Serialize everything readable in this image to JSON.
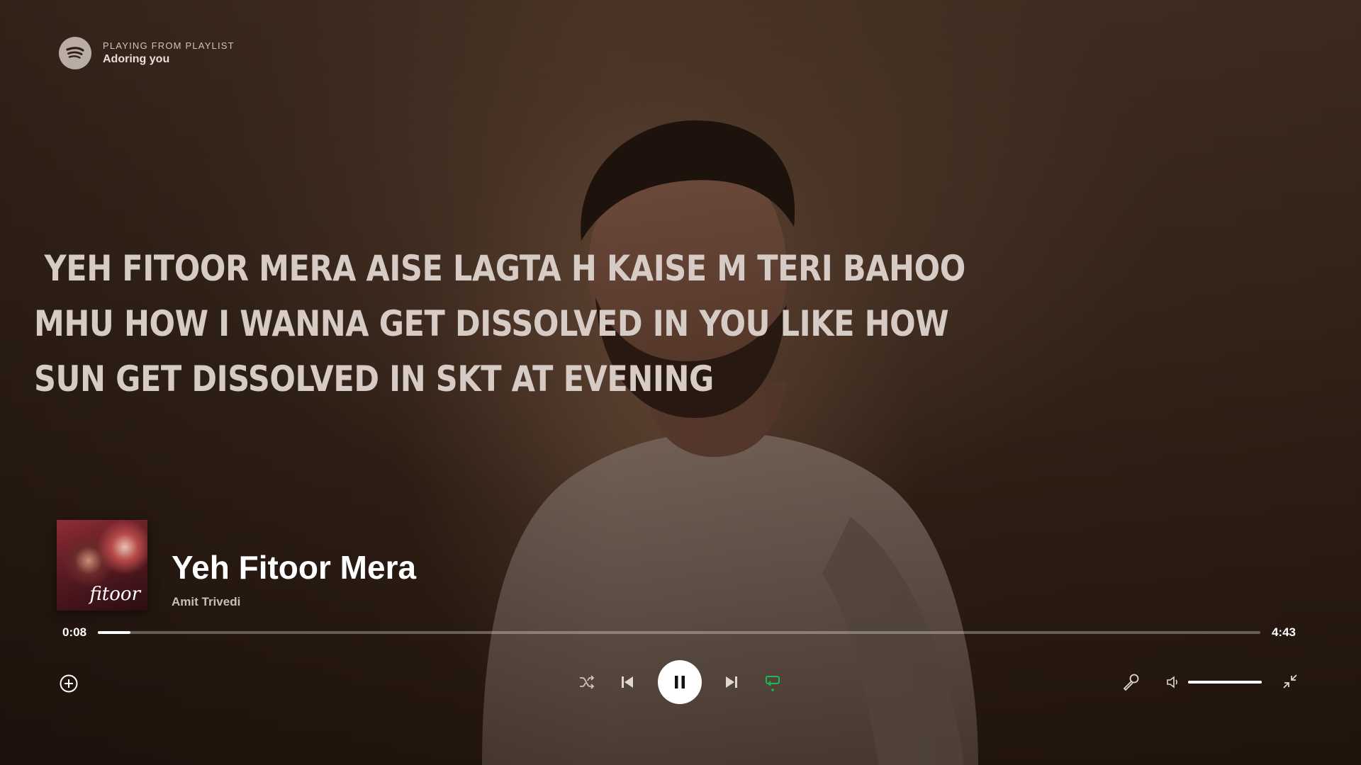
{
  "header": {
    "context_label": "PLAYING FROM PLAYLIST",
    "playlist_name": "Adoring you"
  },
  "lyrics": {
    "lines": [
      " YEH FITOOR MERA AISE LAGTA H KAISE M TERI BAHOO",
      "MHU HOW I WANNA GET DISSOLVED IN YOU LIKE HOW",
      "SUN GET DISSOLVED IN SKT AT EVENING"
    ]
  },
  "now_playing": {
    "cover_text": "fitoor",
    "title": "Yeh Fitoor Mera",
    "artist": "Amit Trivedi"
  },
  "progress": {
    "elapsed": "0:08",
    "duration": "4:43",
    "fraction": 0.028
  },
  "volume": {
    "fraction": 1.0
  },
  "colors": {
    "accent_green": "#1db954",
    "text_white": "#ffffff",
    "lyrics_text": "#d6cbc5"
  },
  "icons": {
    "logo": "spotify-logo-icon",
    "add": "plus-circle-icon",
    "shuffle": "shuffle-icon",
    "previous": "skip-previous-icon",
    "pause": "pause-icon",
    "next": "skip-next-icon",
    "repeat": "repeat-icon",
    "lyrics": "microphone-icon",
    "volume": "volume-icon",
    "fullscreen_exit": "minimize-icon"
  }
}
